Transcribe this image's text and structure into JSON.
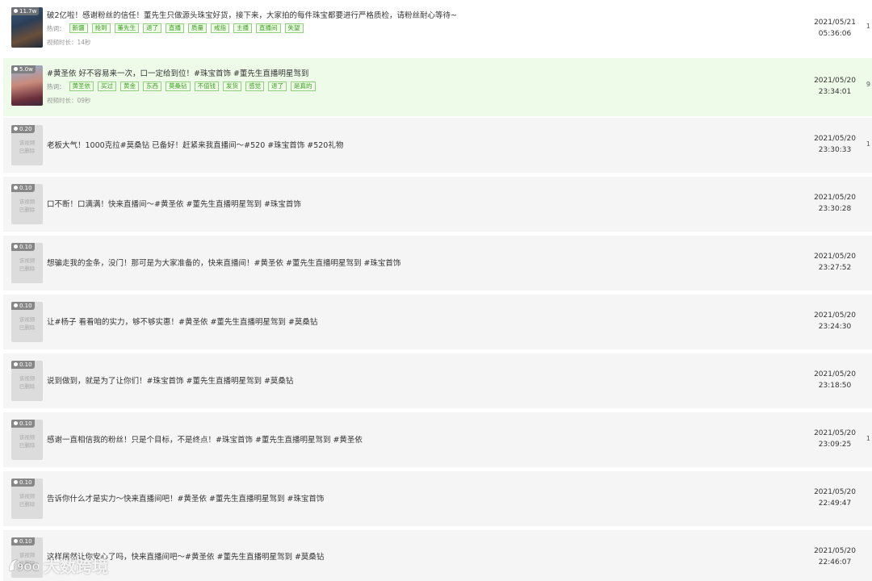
{
  "tags_label": "热词：",
  "rows": [
    {
      "title": "破2亿啦！感谢粉丝的信任！董先生只做源头珠宝好货，接下来，大家拍的每件珠宝都要进行严格质检，请粉丝耐心等待~",
      "badge": "11.7w",
      "tags": [
        "新疆",
        "抢到",
        "董先生",
        "退了",
        "直播",
        "质量",
        "戒指",
        "主播",
        "直播间",
        "失望"
      ],
      "duration": "视频时长：14秒",
      "date": "2021/05/21",
      "time": "05:36:06"
    },
    {
      "title": "#黄圣依 好不容易来一次，口一定给到位！#珠宝首饰 #董先生直播明星驾到",
      "badge": "5.0w",
      "tags": [
        "黄圣依",
        "买过",
        "黄金",
        "东西",
        "莫桑钻",
        "不值钱",
        "发货",
        "感觉",
        "退了",
        "是真的"
      ],
      "duration": "视频时长：09秒",
      "date": "2021/05/20",
      "time": "23:34:01"
    },
    {
      "title": "老板大气！1000克拉#莫桑钻 已备好！赶紧来我直播间～#520 #珠宝首饰 #520礼物",
      "badge": "0.20",
      "date": "2021/05/20",
      "time": "23:30:33"
    },
    {
      "title": "口不断！口满满！快来直播间～#黄圣依 #董先生直播明星驾到 #珠宝首饰",
      "badge": "0.10",
      "date": "2021/05/20",
      "time": "23:30:28"
    },
    {
      "title": "想骗走我的金条，没门！那可是为大家准备的，快来直播间！#黄圣依 #董先生直播明星驾到 #珠宝首饰",
      "badge": "0.10",
      "date": "2021/05/20",
      "time": "23:27:52"
    },
    {
      "title": "让#杨子 看看咱的实力，够不够实惠！#黄圣依 #董先生直播明星驾到 #莫桑钻",
      "badge": "0.10",
      "date": "2021/05/20",
      "time": "23:24:30"
    },
    {
      "title": "说到做到，就是为了让你们！#珠宝首饰 #董先生直播明星驾到 #莫桑钻",
      "badge": "0.10",
      "date": "2021/05/20",
      "time": "23:18:50"
    },
    {
      "title": "感谢一直相信我的粉丝！只是个目标，不是终点！#珠宝首饰 #董先生直播明星驾到 #黄圣依",
      "badge": "0.10",
      "date": "2021/05/20",
      "time": "23:09:25"
    },
    {
      "title": "告诉你什么才是实力～快来直播间吧！#黄圣依 #董先生直播明星驾到 #珠宝首饰",
      "badge": "0.10",
      "date": "2021/05/20",
      "time": "22:49:47"
    },
    {
      "title": "这样居然让你安心了吗，快来直播间吧～#黄圣依 #董先生直播明星驾到 #莫桑钻",
      "badge": "0.10",
      "date": "2021/05/20",
      "time": "22:46:07"
    }
  ],
  "placeholder_line1": "该视频",
  "placeholder_line2": "已删除",
  "edge_chars": [
    "1",
    "9",
    "1",
    "",
    "",
    "",
    "",
    "1",
    "",
    ""
  ],
  "watermark": "大数跨境",
  "watermark_logo_text": "9OO"
}
